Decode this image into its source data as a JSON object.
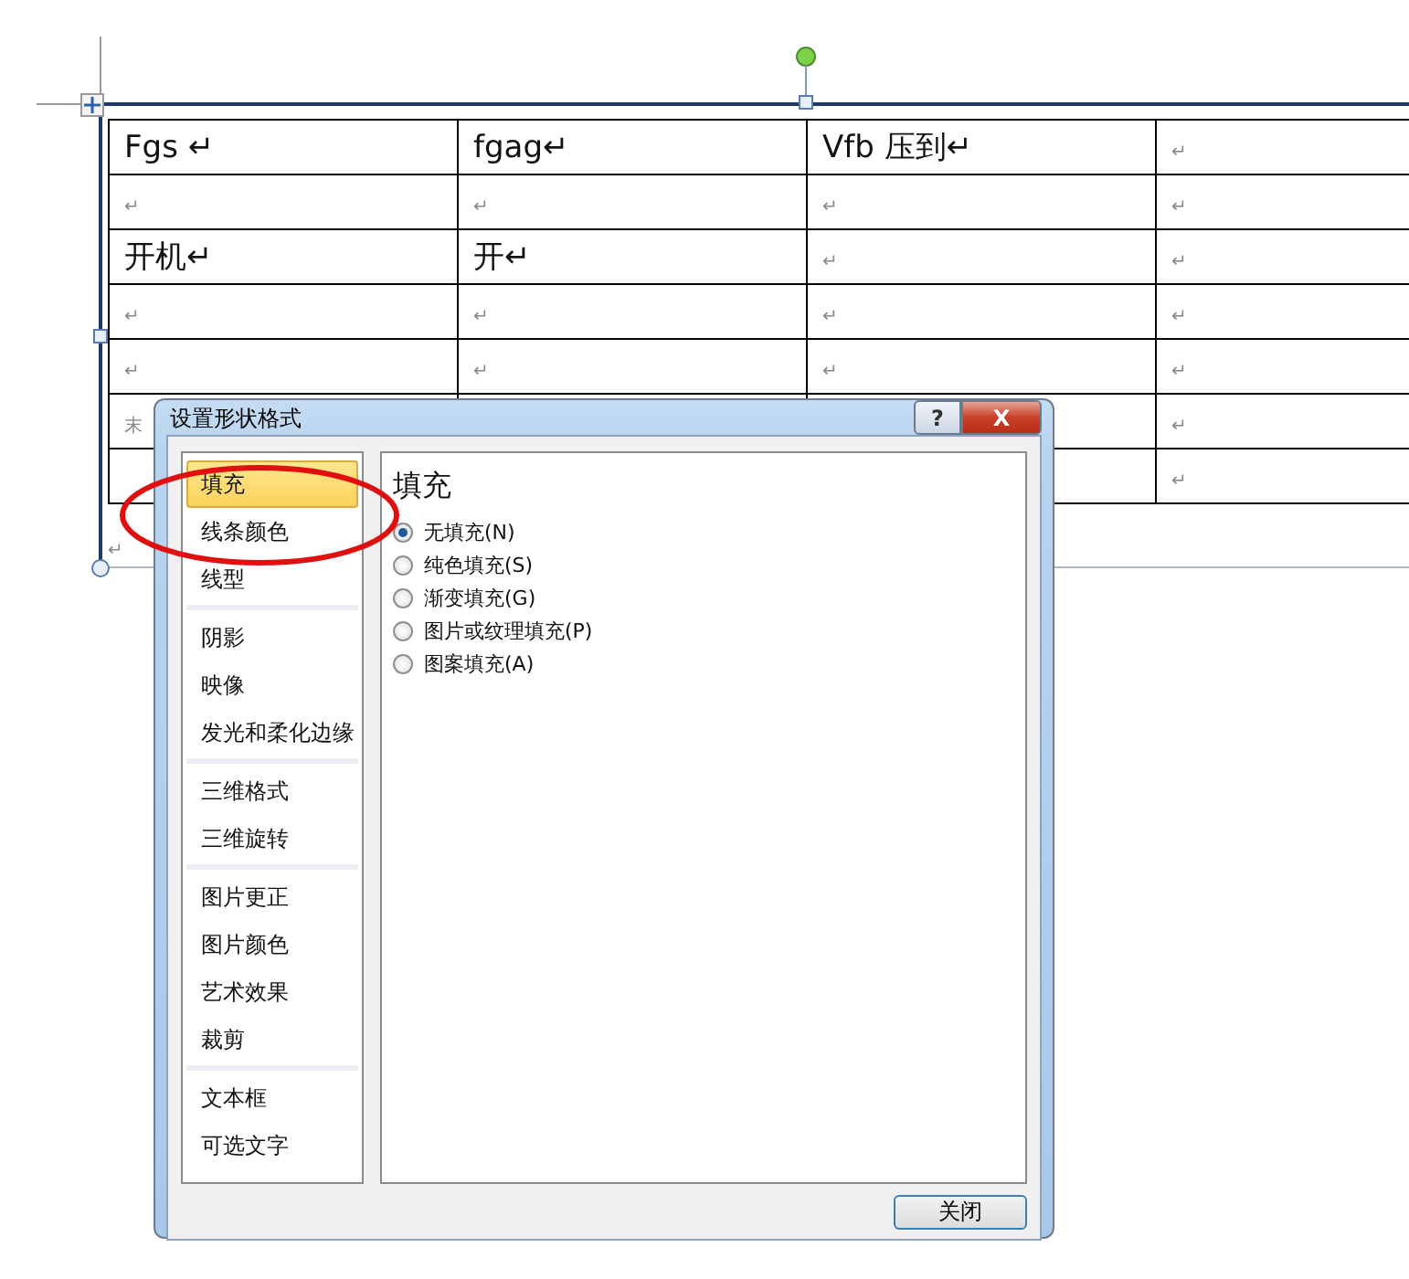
{
  "table": {
    "rows": [
      {
        "cells": [
          "Fgs ↵",
          "fgag↵",
          "Vfb 压到↵",
          "↵"
        ]
      },
      {
        "cells": [
          "↵",
          "↵",
          "↵",
          "↵"
        ]
      },
      {
        "cells": [
          "开机↵",
          "开↵",
          "↵",
          "↵"
        ]
      },
      {
        "cells": [
          "↵",
          "↵",
          "↵",
          "↵"
        ]
      },
      {
        "cells": [
          "↵",
          "↵",
          "↵",
          "↵"
        ]
      },
      {
        "cells": [
          "末",
          null,
          null,
          "↵"
        ]
      },
      {
        "cells": [
          null,
          null,
          null,
          "↵"
        ]
      }
    ]
  },
  "after_table": "↵",
  "dialog": {
    "title": "设置形状格式",
    "help": "?",
    "close_x": "X",
    "sidebar": {
      "groups": [
        {
          "items": [
            {
              "label": "填充",
              "selected": true
            },
            {
              "label": "线条颜色",
              "selected": false
            },
            {
              "label": "线型",
              "selected": false
            }
          ]
        },
        {
          "items": [
            {
              "label": "阴影",
              "selected": false
            },
            {
              "label": "映像",
              "selected": false
            },
            {
              "label": "发光和柔化边缘",
              "selected": false
            }
          ]
        },
        {
          "items": [
            {
              "label": "三维格式",
              "selected": false
            },
            {
              "label": "三维旋转",
              "selected": false
            }
          ]
        },
        {
          "items": [
            {
              "label": "图片更正",
              "selected": false
            },
            {
              "label": "图片颜色",
              "selected": false
            },
            {
              "label": "艺术效果",
              "selected": false
            },
            {
              "label": "裁剪",
              "selected": false
            }
          ]
        },
        {
          "items": [
            {
              "label": "文本框",
              "selected": false
            },
            {
              "label": "可选文字",
              "selected": false
            }
          ]
        }
      ]
    },
    "panel": {
      "heading": "填充",
      "options": [
        {
          "label": "无填充(N)",
          "selected": true
        },
        {
          "label": "纯色填充(S)",
          "selected": false
        },
        {
          "label": "渐变填充(G)",
          "selected": false
        },
        {
          "label": "图片或纹理填充(P)",
          "selected": false
        },
        {
          "label": "图案填充(A)",
          "selected": false
        }
      ]
    },
    "buttons": [
      "关闭"
    ]
  }
}
